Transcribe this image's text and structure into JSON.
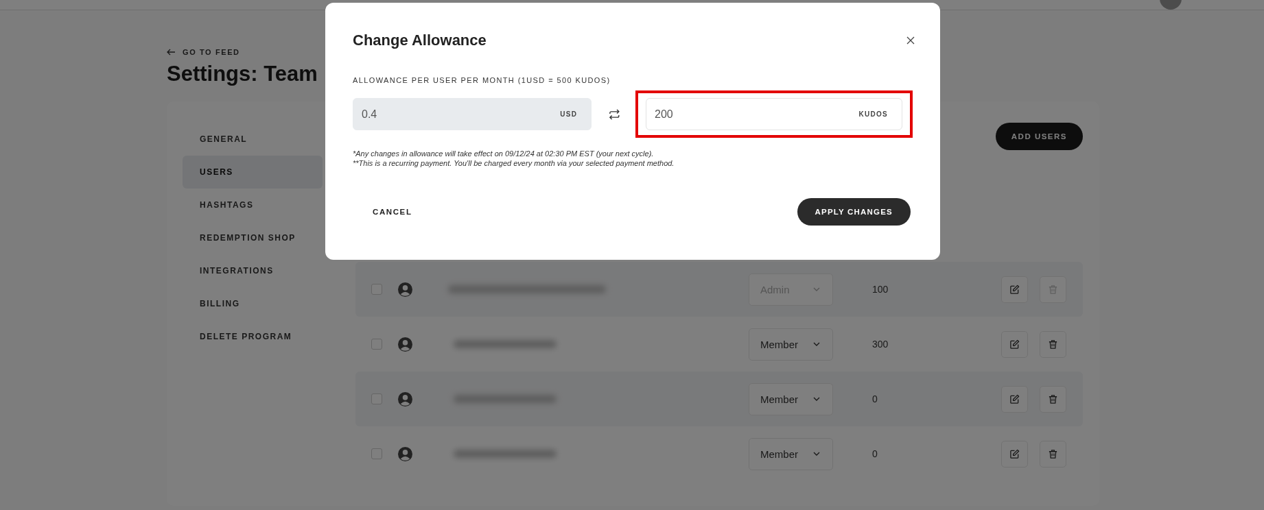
{
  "header": {
    "back_link": "GO TO FEED",
    "title": "Settings: Team"
  },
  "sidebar": {
    "items": [
      {
        "label": "GENERAL",
        "selected": false
      },
      {
        "label": "USERS",
        "selected": true
      },
      {
        "label": "HASHTAGS",
        "selected": false
      },
      {
        "label": "REDEMPTION SHOP",
        "selected": false
      },
      {
        "label": "INTEGRATIONS",
        "selected": false
      },
      {
        "label": "BILLING",
        "selected": false
      },
      {
        "label": "DELETE PROGRAM",
        "selected": false
      }
    ]
  },
  "add_users_button": "ADD USERS",
  "users": [
    {
      "role": "Admin",
      "kudos": "100",
      "role_disabled": true,
      "delete_disabled": true,
      "checked": false
    },
    {
      "role": "Member",
      "kudos": "300",
      "role_disabled": false,
      "delete_disabled": false,
      "checked": false
    },
    {
      "role": "Member",
      "kudos": "0",
      "role_disabled": false,
      "delete_disabled": false,
      "checked": false
    },
    {
      "role": "Member",
      "kudos": "0",
      "role_disabled": false,
      "delete_disabled": false,
      "checked": false
    }
  ],
  "modal": {
    "title": "Change Allowance",
    "field_label": "ALLOWANCE PER USER PER MONTH (1USD = 500 KUDOS)",
    "usd_field": {
      "value": "0.4",
      "unit": "USD",
      "disabled": true
    },
    "kudos_field": {
      "value": "200",
      "unit": "KUDOS",
      "highlighted": true
    },
    "notes": [
      "*Any changes in allowance will take effect on 09/12/24 at 02:30 PM EST (your next cycle).",
      "**This is a recurring payment. You'll be charged every month via your selected payment method."
    ],
    "cancel": "CANCEL",
    "apply": "APPLY CHANGES"
  }
}
